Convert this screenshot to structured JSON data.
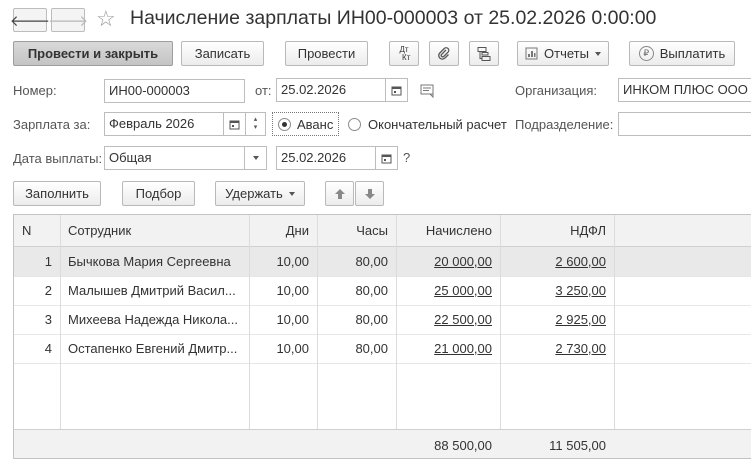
{
  "window": {
    "title": "Начисление зарплаты ИН00-000003 от 25.02.2026 0:00:00"
  },
  "toolbar": {
    "post_and_close": "Провести и закрыть",
    "save": "Записать",
    "post": "Провести",
    "dt_kt": "Дт Кт",
    "reports": "Отчеты",
    "pay": "Выплатить"
  },
  "form": {
    "number_label": "Номер:",
    "number_value": "ИН00-000003",
    "from_label": "от:",
    "date_value": "25.02.2026",
    "organization_label": "Организация:",
    "organization_value": "ИНКОМ ПЛЮС ООО",
    "salary_for_label": "Зарплата за:",
    "salary_for_value": "Февраль 2026",
    "advance_label": "Аванс",
    "final_label": "Окончательный расчет",
    "subdivision_label": "Подразделение:",
    "subdivision_value": "",
    "pay_date_label": "Дата выплаты:",
    "pay_type_value": "Общая",
    "pay_date_value": "25.02.2026",
    "help": "?"
  },
  "table_toolbar": {
    "fill": "Заполнить",
    "select": "Подбор",
    "withhold": "Удержать"
  },
  "table": {
    "columns": [
      "N",
      "Сотрудник",
      "Дни",
      "Часы",
      "Начислено",
      "НДФЛ"
    ],
    "rows": [
      {
        "n": "1",
        "employee": "Бычкова Мария Сергеевна",
        "days": "10,00",
        "hours": "80,00",
        "accrued": "20 000,00",
        "ndfl": "2 600,00"
      },
      {
        "n": "2",
        "employee": "Малышев Дмитрий Васил...",
        "days": "10,00",
        "hours": "80,00",
        "accrued": "25 000,00",
        "ndfl": "3 250,00"
      },
      {
        "n": "3",
        "employee": "Михеева Надежда Никола...",
        "days": "10,00",
        "hours": "80,00",
        "accrued": "22 500,00",
        "ndfl": "2 925,00"
      },
      {
        "n": "4",
        "employee": "Остапенко Евгений Дмитр...",
        "days": "10,00",
        "hours": "80,00",
        "accrued": "21 000,00",
        "ndfl": "2 730,00"
      }
    ],
    "totals": {
      "accrued": "88 500,00",
      "ndfl": "11 505,00"
    }
  },
  "icons": [
    "back-arrow-icon",
    "forward-arrow-icon",
    "star-icon",
    "dt-kt-icon",
    "paperclip-icon",
    "structure-icon",
    "reports-icon",
    "coin-icon",
    "calendar-icon",
    "spin-updown-icon",
    "dropdown-icon",
    "comment-icon",
    "move-up-icon",
    "move-down-icon"
  ]
}
